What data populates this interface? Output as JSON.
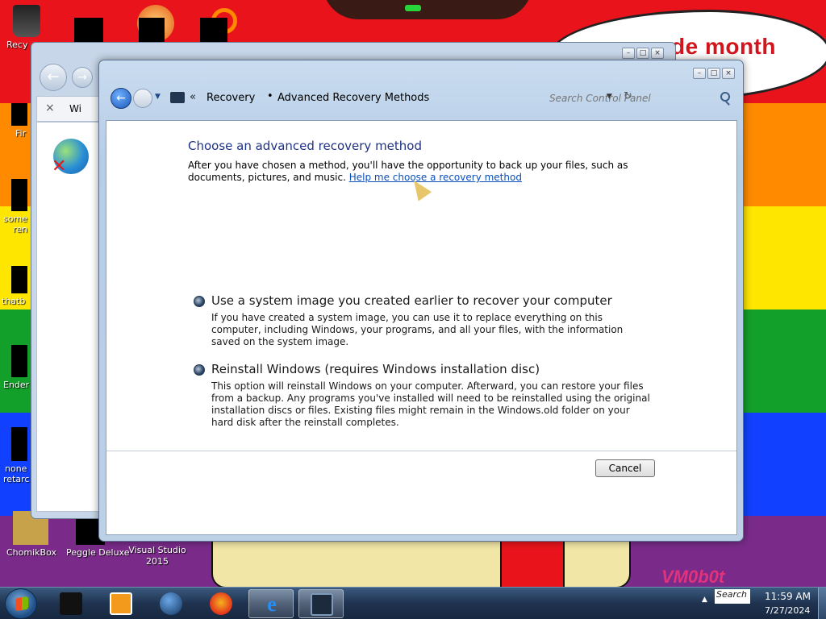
{
  "wallpaper": {
    "speech_text": "de month",
    "watermark": "VM0b0t"
  },
  "desktop_icons": [
    {
      "label": "Recy"
    },
    {
      "label": "Fir"
    },
    {
      "label": "some"
    },
    {
      "label": "ren"
    },
    {
      "label": "thatb"
    },
    {
      "label": "Ender"
    },
    {
      "label": "none"
    },
    {
      "label": "retarc"
    },
    {
      "label": "ChomikBox"
    },
    {
      "label": "Peggle Deluxe"
    },
    {
      "label": "Visual Studio 2015"
    }
  ],
  "back_window": {
    "tab_label": "Wi"
  },
  "window": {
    "breadcrumb": [
      "Recovery",
      "Advanced Recovery Methods"
    ],
    "breadcrumb_separator": "•",
    "overflow_chevron": "«",
    "search_placeholder": "Search Control Panel",
    "heading": "Choose an advanced recovery method",
    "intro_text": "After you have chosen a method, you'll have the opportunity to back up your files, such as documents, pictures, and music. ",
    "help_link": "Help me choose a recovery method",
    "options": [
      {
        "title": "Use a system image you created earlier to recover your computer",
        "description": "If you have created a system image, you can use it to replace everything on this computer, including Windows, your programs, and all your files, with the information saved on the system image."
      },
      {
        "title": "Reinstall Windows (requires Windows installation disc)",
        "description": "This option will reinstall Windows on your computer. Afterward, you can restore your files from a backup. Any programs you've installed will need to be reinstalled using the original installation discs or files. Existing files might remain in the Windows.old folder on your hard disk after the reinstall completes."
      }
    ],
    "cancel_label": "Cancel"
  },
  "taskbar": {
    "apps": [
      {
        "icon": "console-icon"
      },
      {
        "icon": "media-player-icon"
      },
      {
        "icon": "globe-app-icon"
      },
      {
        "icon": "firefox-icon"
      },
      {
        "icon": "internet-explorer-icon",
        "active": true
      },
      {
        "icon": "control-panel-icon",
        "active": true
      }
    ],
    "tray_search": "Search C",
    "clock_time": "11:59 AM",
    "clock_date": "7/27/2024"
  },
  "colors": {
    "heading": "#1e3287",
    "link": "#0b4fb8",
    "wallpaper_red": "#e8131b",
    "wallpaper_orange": "#ff8a00",
    "wallpaper_yellow": "#ffe600",
    "wallpaper_green": "#12a02a",
    "wallpaper_blue": "#1141ff",
    "wallpaper_purple": "#7a2b8a"
  }
}
